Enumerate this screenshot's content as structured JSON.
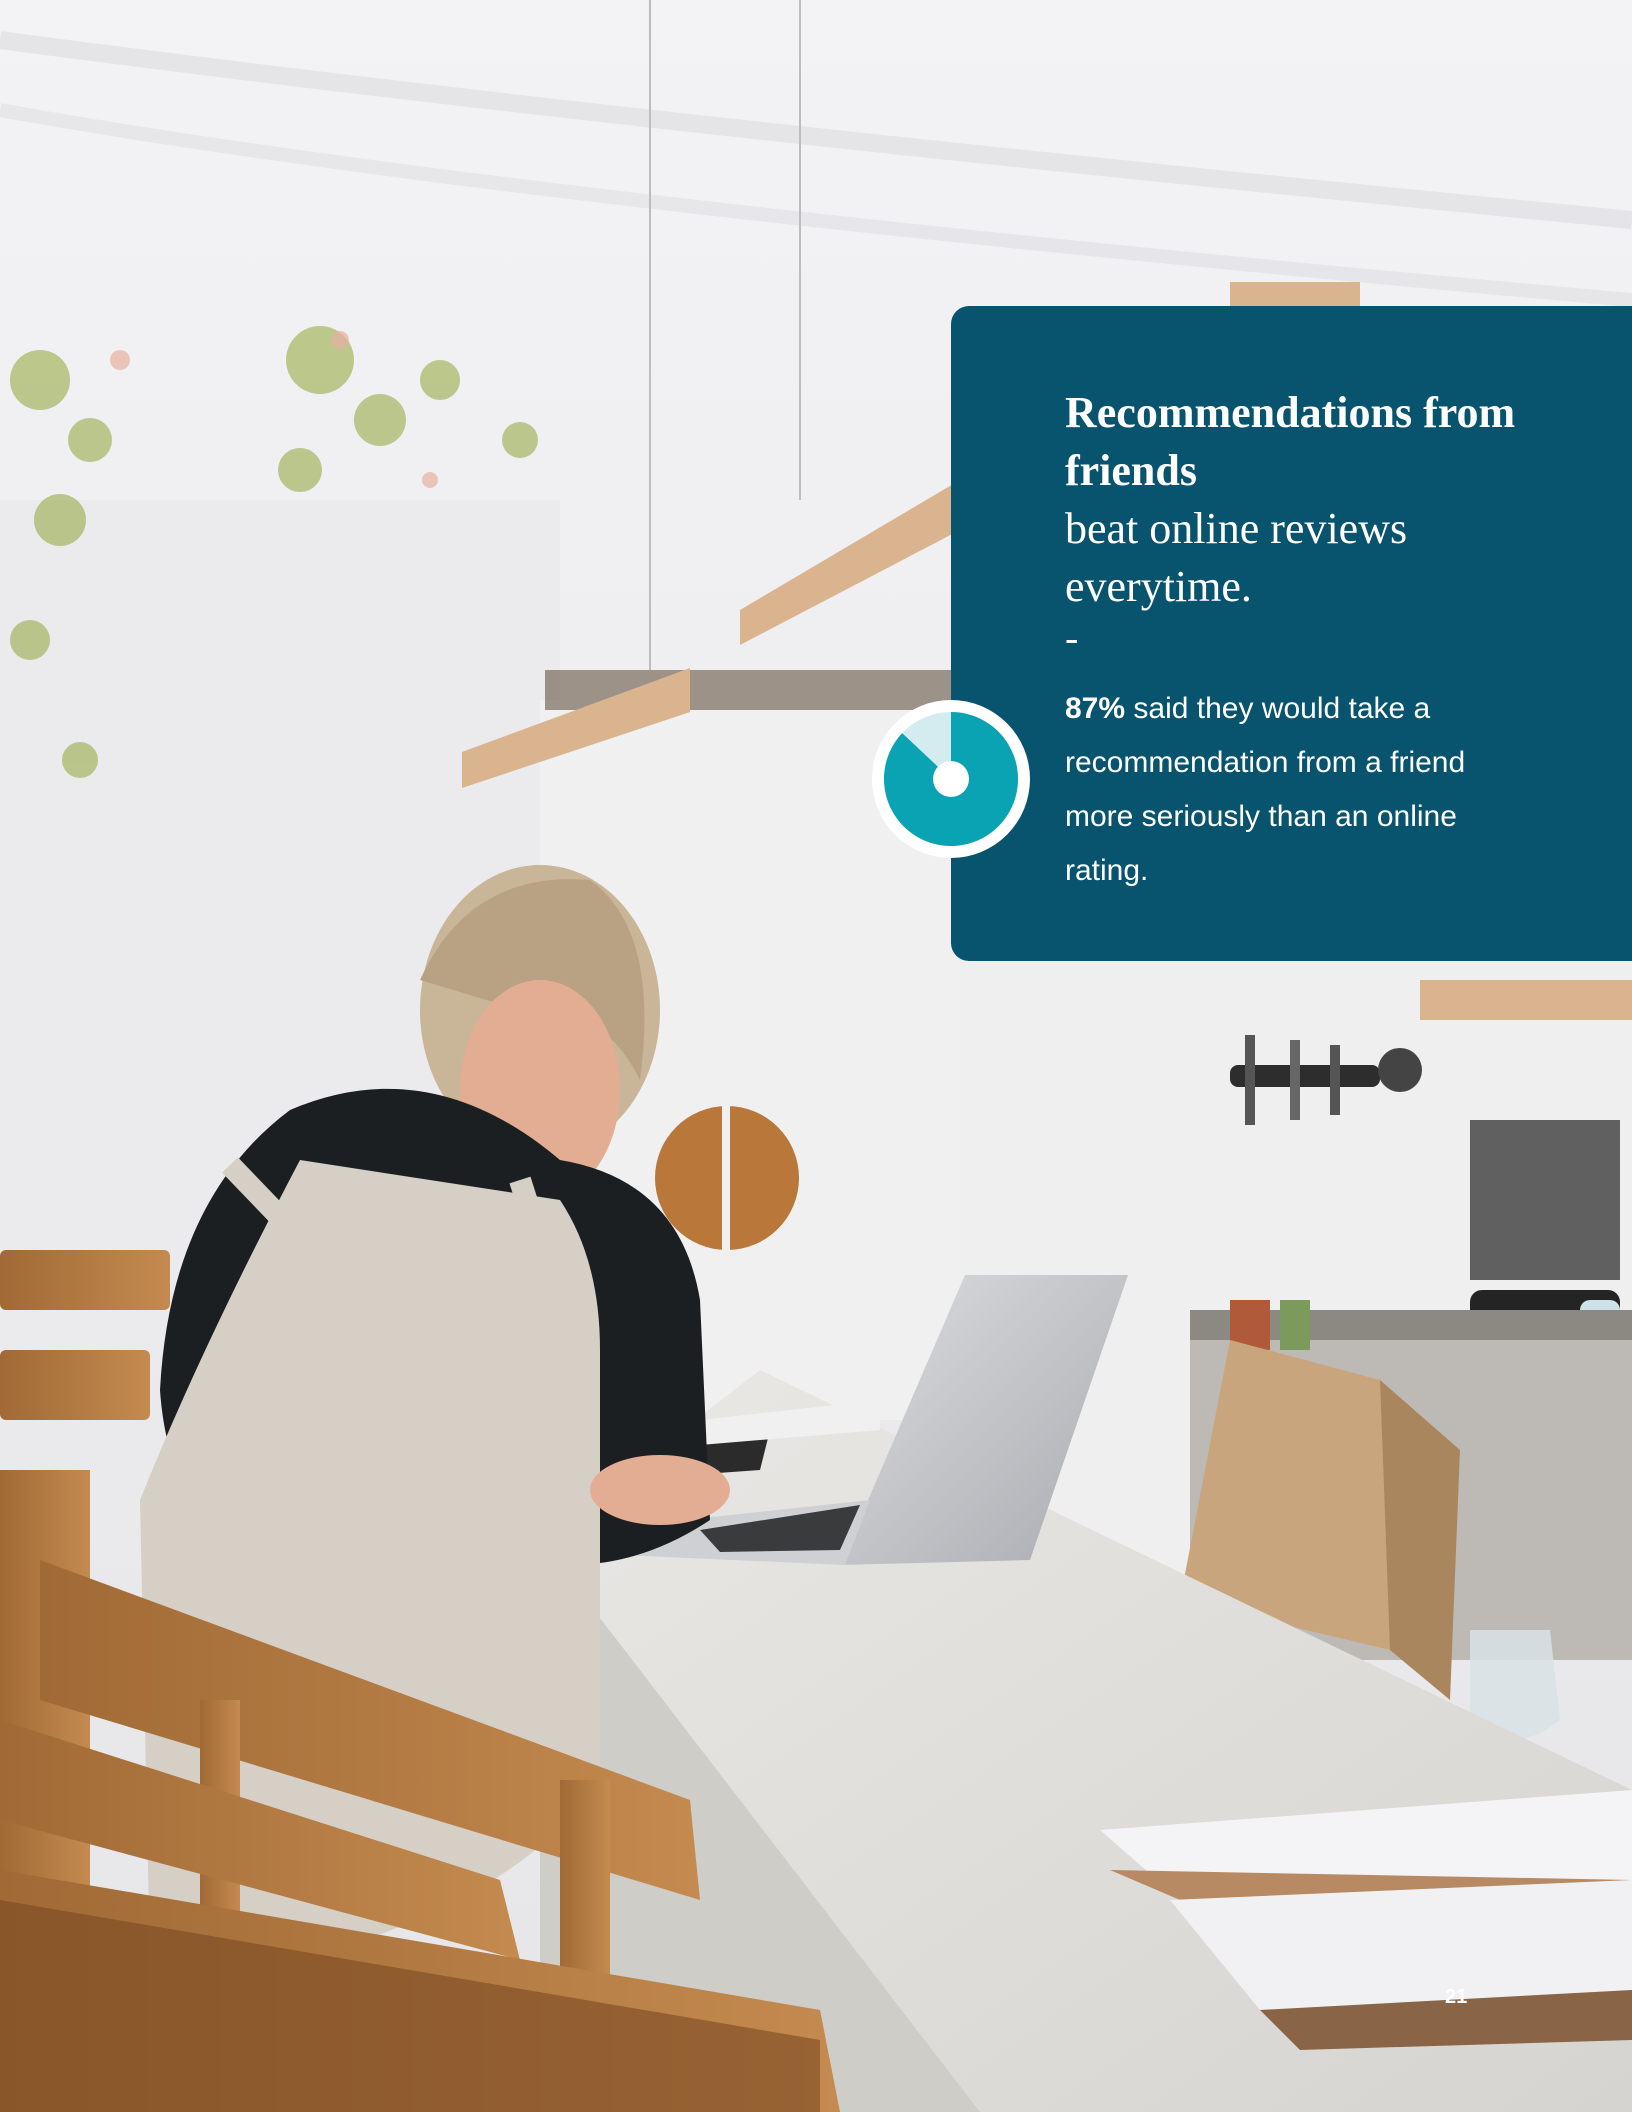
{
  "callout": {
    "headline_bold": "Recommendations from friends",
    "headline_rest": "beat online reviews everytime.",
    "dash": "-",
    "stat_value": "87%",
    "stat_text": " said they would take a recommendation from a friend more seriously than an online rating.",
    "stat_fraction": 0.87
  },
  "page_number": "21",
  "colors": {
    "card_background": "#08536e",
    "donut_fill": "#0aa3b3",
    "donut_remainder": "#d4ecef",
    "text": "#ffffff"
  },
  "icons": {
    "stat_icon": "donut-percentage-icon"
  }
}
